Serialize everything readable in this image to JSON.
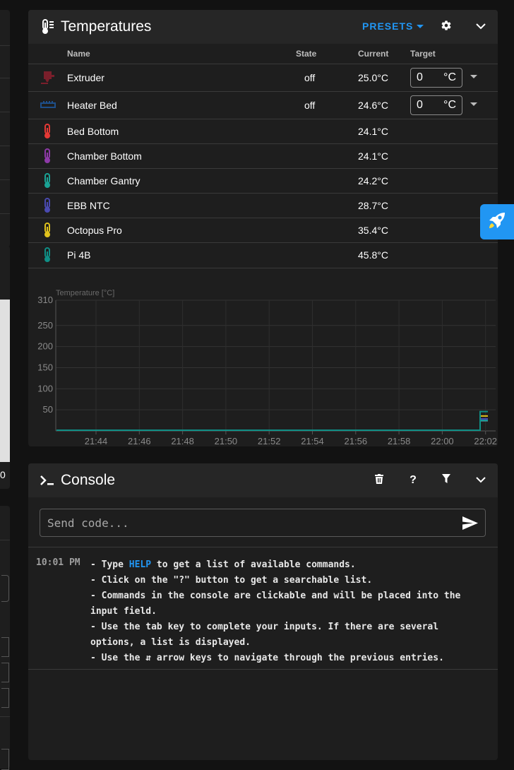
{
  "temperatures": {
    "title": "Temperatures",
    "presets_label": "PRESETS",
    "columns": {
      "name": "Name",
      "state": "State",
      "current": "Current",
      "target": "Target"
    },
    "heaters": [
      {
        "name": "Extruder",
        "state": "off",
        "current": "25.0°C",
        "target": "0",
        "unit": "°C",
        "icon": "extruder-icon",
        "color": "#7a1f2b"
      },
      {
        "name": "Heater Bed",
        "state": "off",
        "current": "24.6°C",
        "target": "0",
        "unit": "°C",
        "icon": "heater-bed-icon",
        "color": "#1e4f8a"
      }
    ],
    "sensors": [
      {
        "name": "Bed Bottom",
        "current": "24.1°C",
        "color": "#e53935"
      },
      {
        "name": "Chamber Bottom",
        "current": "24.1°C",
        "color": "#8e3aa8"
      },
      {
        "name": "Chamber Gantry",
        "current": "24.2°C",
        "color": "#1aa395"
      },
      {
        "name": "EBB NTC",
        "current": "28.7°C",
        "color": "#4a4ab0"
      },
      {
        "name": "Octopus Pro",
        "current": "35.4°C",
        "color": "#e0c21c"
      },
      {
        "name": "Pi 4B",
        "current": "45.8°C",
        "color": "#0f8f86"
      }
    ]
  },
  "chart_data": {
    "type": "line",
    "ylabel": "Temperature [°C]",
    "ylim": [
      0,
      310
    ],
    "yticks": [
      310,
      250,
      200,
      150,
      100,
      50
    ],
    "x_ticks": [
      "21:44",
      "21:46",
      "21:48",
      "21:50",
      "21:52",
      "21:54",
      "21:56",
      "21:58",
      "22:00",
      "22:02"
    ],
    "grid": true,
    "series": [
      {
        "name": "Extruder",
        "color": "#2196f3",
        "values": [
          25.0
        ]
      },
      {
        "name": "Heater Bed",
        "color": "#1e4f8a",
        "values": [
          24.6
        ]
      },
      {
        "name": "Bed Bottom",
        "color": "#e53935",
        "values": [
          24.1
        ]
      },
      {
        "name": "Chamber Bottom",
        "color": "#8e3aa8",
        "values": [
          24.1
        ]
      },
      {
        "name": "Chamber Gantry",
        "color": "#1aa395",
        "values": [
          24.2
        ]
      },
      {
        "name": "EBB NTC",
        "color": "#4a4ab0",
        "values": [
          28.7
        ]
      },
      {
        "name": "Octopus Pro",
        "color": "#e0c21c",
        "values": [
          35.4
        ]
      },
      {
        "name": "Pi 4B",
        "color": "#0f8f86",
        "values": [
          45.8
        ]
      }
    ]
  },
  "console": {
    "title": "Console",
    "placeholder": "Send code...",
    "timestamp": "10:01 PM",
    "msg_l1_a": "- Type ",
    "msg_help": "HELP",
    "msg_l1_b": " to get a list of available commands.",
    "msg_rest": "- Click on the \"?\" button to get a searchable list.\n- Commands in the console are clickable and will be placed into the input field.\n- Use the tab key to complete your inputs. If there are several options, a list is displayed.\n- Use the ⇵ arrow keys to navigate through the previous entries.",
    "cut_off_digit": "0"
  }
}
